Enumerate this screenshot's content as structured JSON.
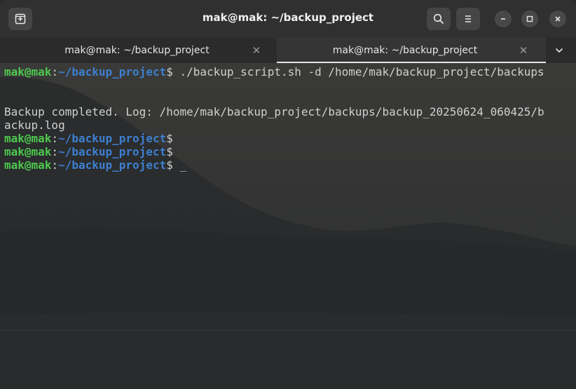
{
  "window": {
    "title": "mak@mak: ~/backup_project"
  },
  "tabs": [
    {
      "label": "mak@mak: ~/backup_project",
      "active": false
    },
    {
      "label": "mak@mak: ~/backup_project",
      "active": true
    }
  ],
  "terminal": {
    "prompt_user": "mak@mak",
    "prompt_sep": ":",
    "prompt_path": "~/backup_project",
    "prompt_symbol": "$",
    "command": " ./backup_script.sh -d /home/mak/backup_project/backups",
    "output_line1": "Backup completed. Log: /home/mak/backup_project/backups/backup_20250624_060425/b",
    "output_line2": "ackup.log",
    "cursor": "_"
  },
  "icons": {
    "new_tab": "new-tab-icon",
    "search": "search-icon",
    "menu": "hamburger-menu-icon",
    "minimize": "minimize-icon",
    "maximize": "maximize-icon",
    "close": "close-icon",
    "tab_close": "tab-close-icon",
    "tab_list": "chevron-down-icon"
  },
  "colors": {
    "prompt_user": "#4ec94e",
    "prompt_path": "#3e7fd0",
    "text": "#d0d0d0",
    "headerbar": "#303030"
  }
}
